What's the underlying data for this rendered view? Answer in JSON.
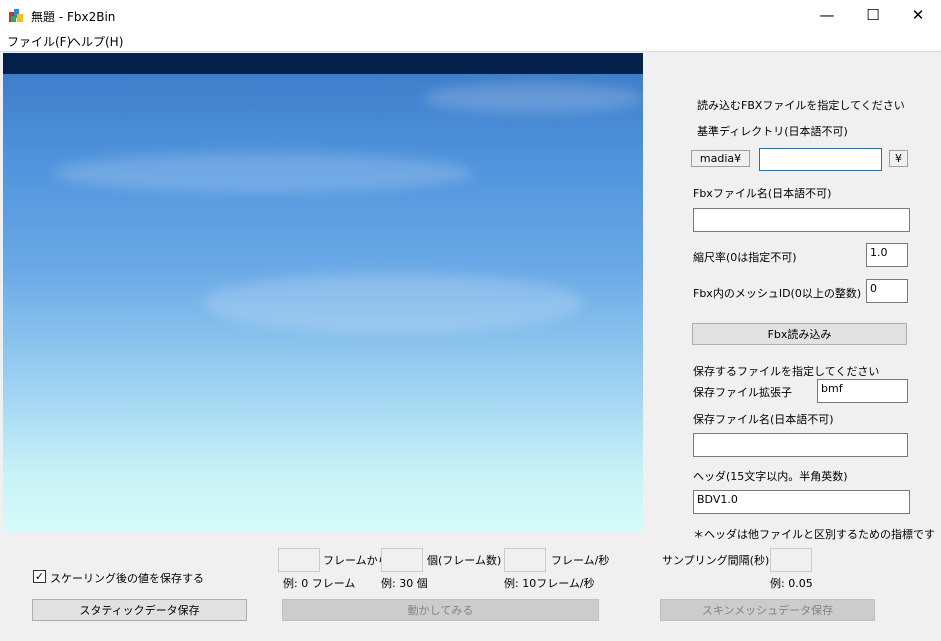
{
  "window": {
    "title": "無題 - Fbx2Bin",
    "minimize": "—",
    "maximize": "☐",
    "close": "✕"
  },
  "menu": {
    "file": "ファイル(F)",
    "help": "ヘルプ(H)"
  },
  "panel": {
    "heading_load": "読み込むFBXファイルを指定してください",
    "base_dir_label": "基準ディレクトリ(日本語不可)",
    "base_dir_prefix": "madia¥",
    "base_dir_value": "",
    "base_dir_suffix": "¥",
    "fbx_name_label": "Fbxファイル名(日本語不可)",
    "fbx_name_value": "",
    "scale_label": "縮尺率(0は指定不可)",
    "scale_value": "1.0",
    "mesh_id_label": "Fbx内のメッシュID(0以上の整数)",
    "mesh_id_value": "0",
    "load_button": "Fbx読み込み",
    "heading_save": "保存するファイルを指定してください",
    "ext_label": "保存ファイル拡張子",
    "ext_value": "bmf",
    "save_name_label": "保存ファイル名(日本語不可)",
    "save_name_value": "",
    "header_label": "ヘッダ(15文字以内。半角英数)",
    "header_value": "BDV1.0",
    "header_note": "＊ヘッダは他ファイルと区別するための指標です"
  },
  "bottom": {
    "checkbox_label": "スケーリング後の値を保存する",
    "checkbox_checked": true,
    "frame_from_label": "フレームから",
    "frame_count_label": "個(フレーム数)",
    "fps_label": "フレーム/秒",
    "sampling_label": "サンプリング間隔(秒)",
    "ex_frame_from": "例: 0 フレーム",
    "ex_frame_count": "例: 30 個",
    "ex_fps": "例: 10フレーム/秒",
    "ex_sampling": "例: 0.05",
    "static_save_button": "スタティックデータ保存",
    "animate_button": "動かしてみる",
    "skin_save_button": "スキンメッシュデータ保存"
  }
}
